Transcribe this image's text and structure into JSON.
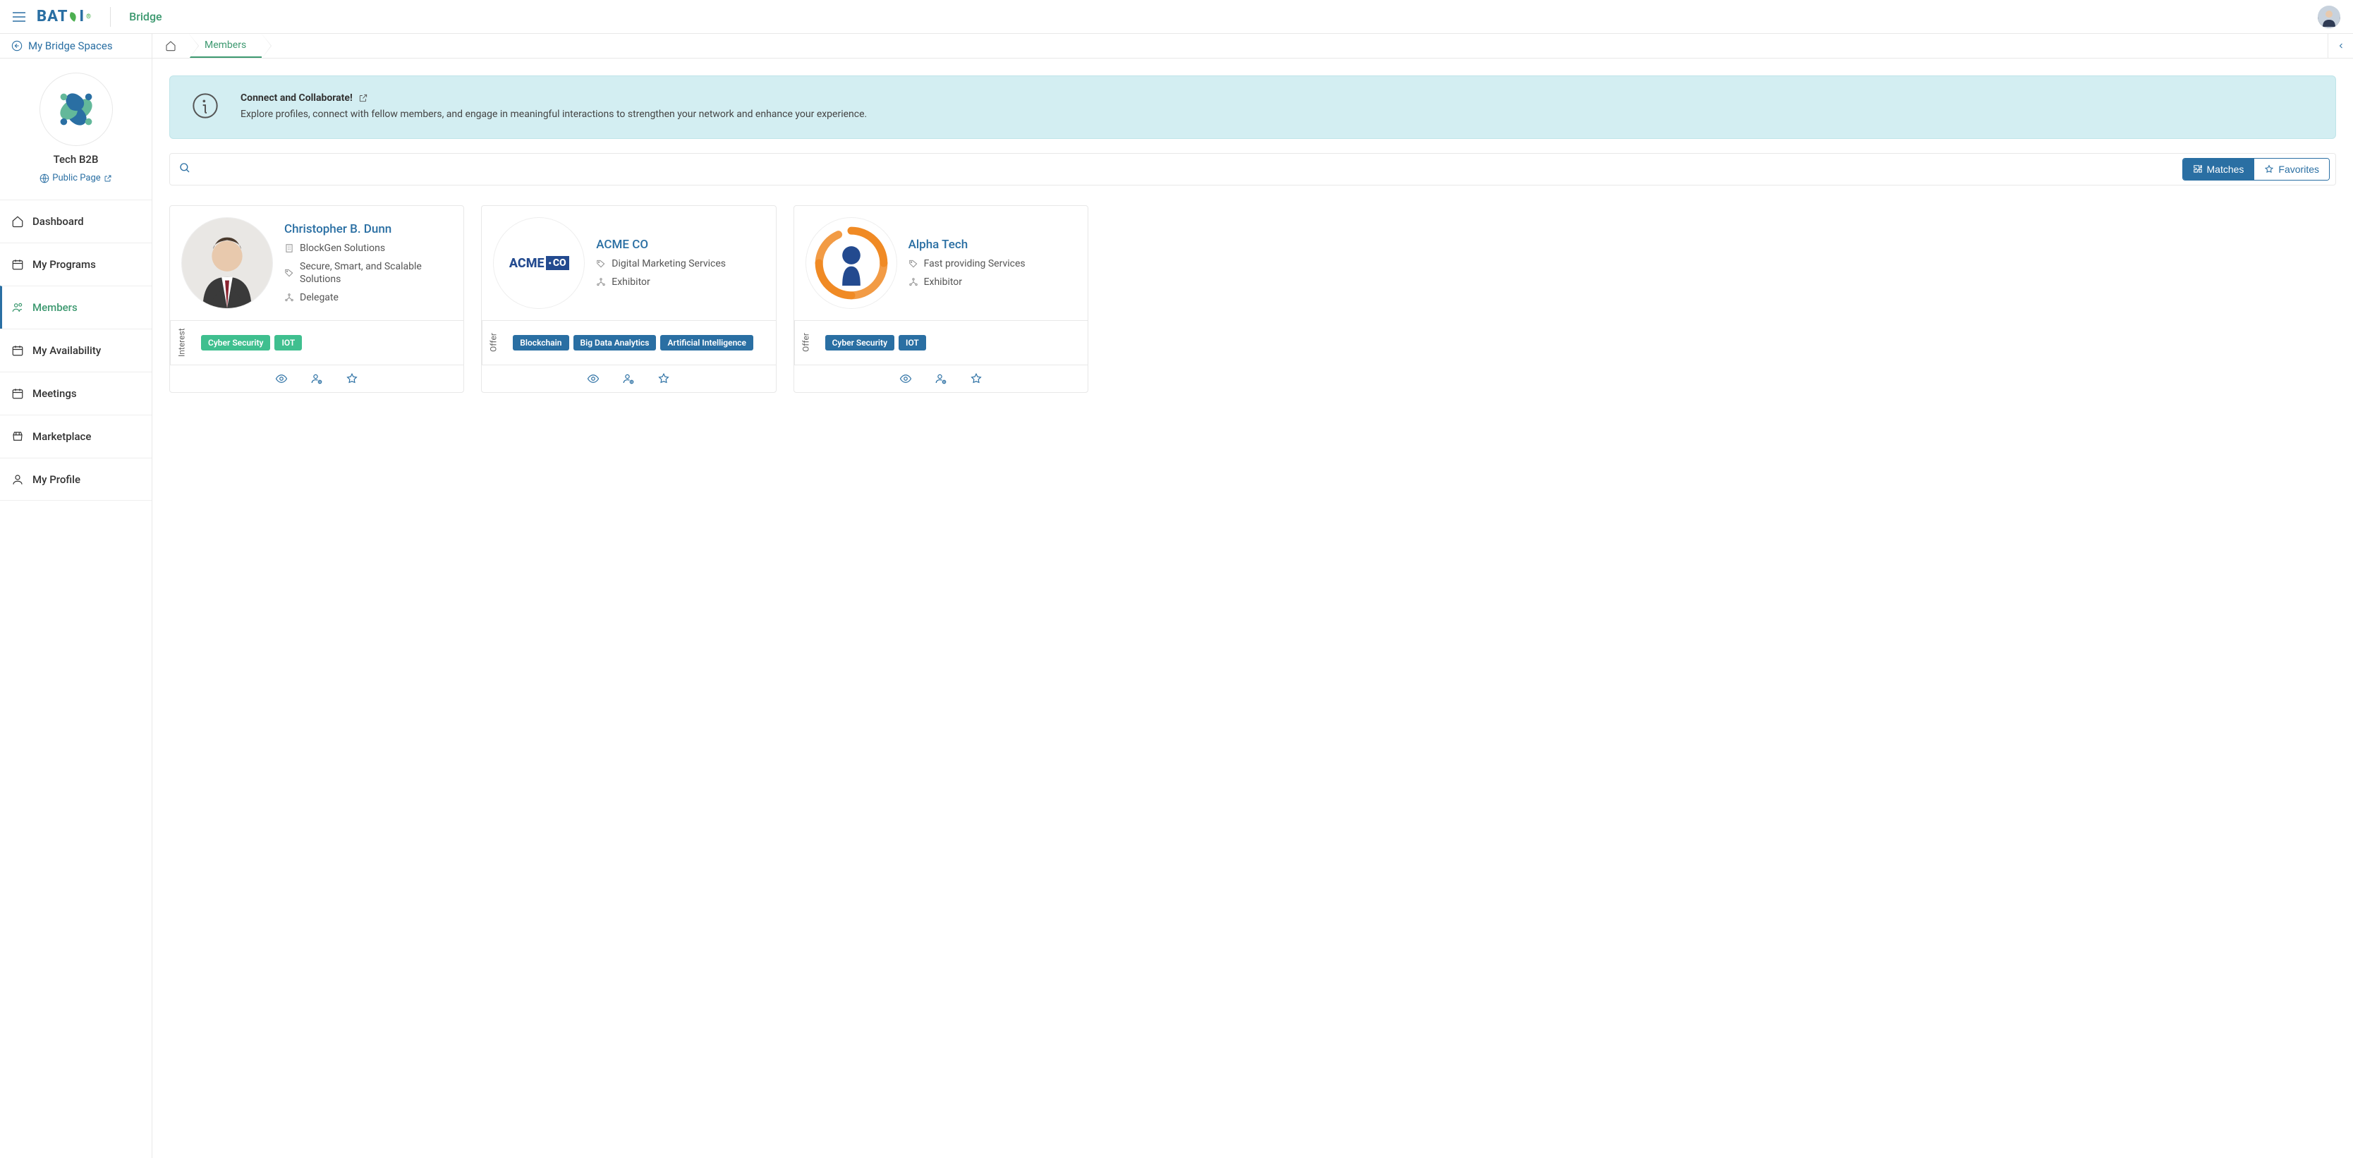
{
  "header": {
    "brand_primary": "BAT",
    "brand_secondary": "I",
    "product": "Bridge"
  },
  "sidebar": {
    "back_label": "My Bridge Spaces",
    "space_name": "Tech B2B",
    "public_page_label": "Public Page",
    "nav": [
      {
        "key": "dashboard",
        "label": "Dashboard"
      },
      {
        "key": "programs",
        "label": "My Programs"
      },
      {
        "key": "members",
        "label": "Members"
      },
      {
        "key": "availability",
        "label": "My Availability"
      },
      {
        "key": "meetings",
        "label": "Meetings"
      },
      {
        "key": "marketplace",
        "label": "Marketplace"
      },
      {
        "key": "profile",
        "label": "My Profile"
      }
    ]
  },
  "breadcrumb": {
    "current": "Members"
  },
  "banner": {
    "title": "Connect and Collaborate!",
    "description": "Explore profiles, connect with fellow members, and engage in meaningful interactions to strengthen your network and enhance your experience."
  },
  "toolbar": {
    "matches_label": "Matches",
    "favorites_label": "Favorites"
  },
  "members": [
    {
      "name": "Christopher B. Dunn",
      "company": "BlockGen Solutions",
      "tagline": "Secure, Smart, and Scalable Solutions",
      "role": "Delegate",
      "tag_type": "Interest",
      "tag_style": "green",
      "tags": [
        "Cyber Security",
        "IOT"
      ]
    },
    {
      "name": "ACME CO",
      "company": null,
      "tagline": "Digital Marketing Services",
      "role": "Exhibitor",
      "tag_type": "Offer",
      "tag_style": "blue",
      "tags": [
        "Blockchain",
        "Big Data Analytics",
        "Artificial Intelligence"
      ]
    },
    {
      "name": "Alpha Tech",
      "company": null,
      "tagline": "Fast providing Services",
      "role": "Exhibitor",
      "tag_type": "Offer",
      "tag_style": "blue",
      "tags": [
        "Cyber Security",
        "IOT"
      ]
    }
  ]
}
